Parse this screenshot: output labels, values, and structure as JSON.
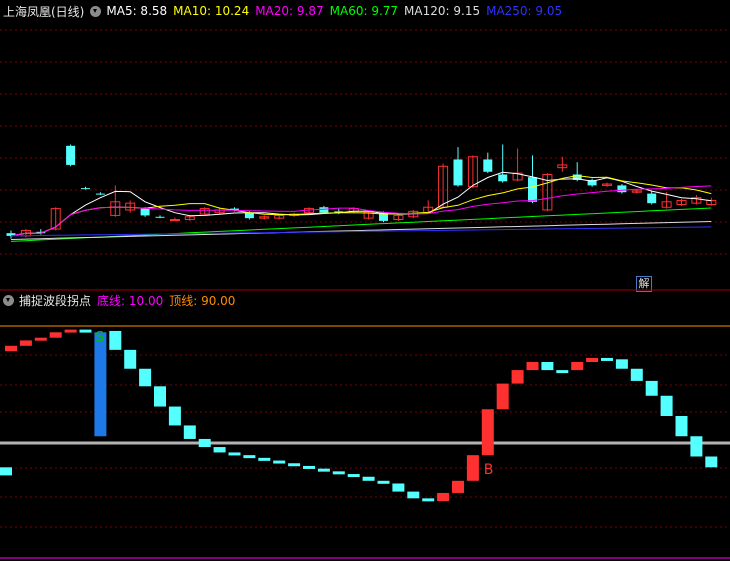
{
  "main": {
    "title": "上海凤凰(日线)",
    "ma": [
      {
        "label": "MA5: 8.58",
        "color": "#ffffff"
      },
      {
        "label": "MA10: 10.24",
        "color": "#ffff00"
      },
      {
        "label": "MA20: 9.87",
        "color": "#ff00ff"
      },
      {
        "label": "MA60: 9.77",
        "color": "#00ff00"
      },
      {
        "label": "MA120: 9.15",
        "color": "#dcdcdc"
      },
      {
        "label": "MA250: 9.05",
        "color": "#3030ff"
      }
    ],
    "badge": "解",
    "candles": [
      {
        "o": 8.85,
        "c": 8.75,
        "h": 8.95,
        "l": 8.65,
        "up": false
      },
      {
        "o": 8.75,
        "c": 8.95,
        "h": 9.0,
        "l": 8.7,
        "up": true
      },
      {
        "o": 8.9,
        "c": 8.85,
        "h": 9.0,
        "l": 8.8,
        "up": false
      },
      {
        "o": 9.0,
        "c": 9.75,
        "h": 9.8,
        "l": 8.95,
        "up": true
      },
      {
        "o": 12.05,
        "c": 11.35,
        "h": 12.1,
        "l": 11.3,
        "up": false
      },
      {
        "o": 10.5,
        "c": 10.5,
        "h": 10.55,
        "l": 10.45,
        "up": false
      },
      {
        "o": 10.3,
        "c": 10.3,
        "h": 10.35,
        "l": 10.25,
        "up": false
      },
      {
        "o": 9.5,
        "c": 10.0,
        "h": 10.6,
        "l": 9.45,
        "up": true
      },
      {
        "o": 9.95,
        "c": 9.7,
        "h": 10.05,
        "l": 9.6,
        "up": true
      },
      {
        "o": 9.75,
        "c": 9.5,
        "h": 9.8,
        "l": 9.45,
        "up": false
      },
      {
        "o": 9.45,
        "c": 9.45,
        "h": 9.5,
        "l": 9.4,
        "up": false
      },
      {
        "o": 9.35,
        "c": 9.35,
        "h": 9.42,
        "l": 9.3,
        "up": true
      },
      {
        "o": 9.35,
        "c": 9.45,
        "h": 9.5,
        "l": 9.3,
        "up": true
      },
      {
        "o": 9.55,
        "c": 9.75,
        "h": 9.8,
        "l": 9.5,
        "up": true
      },
      {
        "o": 9.6,
        "c": 9.7,
        "h": 9.8,
        "l": 9.55,
        "up": true
      },
      {
        "o": 9.75,
        "c": 9.7,
        "h": 9.8,
        "l": 9.65,
        "up": false
      },
      {
        "o": 9.6,
        "c": 9.4,
        "h": 9.65,
        "l": 9.35,
        "up": false
      },
      {
        "o": 9.4,
        "c": 9.45,
        "h": 9.5,
        "l": 9.35,
        "up": true
      },
      {
        "o": 9.4,
        "c": 9.5,
        "h": 9.55,
        "l": 9.35,
        "up": true
      },
      {
        "o": 9.5,
        "c": 9.55,
        "h": 9.6,
        "l": 9.45,
        "up": true
      },
      {
        "o": 9.6,
        "c": 9.75,
        "h": 9.8,
        "l": 9.55,
        "up": true
      },
      {
        "o": 9.8,
        "c": 9.6,
        "h": 9.85,
        "l": 9.55,
        "up": false
      },
      {
        "o": 9.65,
        "c": 9.6,
        "h": 9.75,
        "l": 9.55,
        "up": false
      },
      {
        "o": 9.65,
        "c": 9.75,
        "h": 9.8,
        "l": 9.6,
        "up": true
      },
      {
        "o": 9.4,
        "c": 9.6,
        "h": 9.65,
        "l": 9.35,
        "up": true
      },
      {
        "o": 9.6,
        "c": 9.3,
        "h": 9.65,
        "l": 9.25,
        "up": false
      },
      {
        "o": 9.35,
        "c": 9.5,
        "h": 9.55,
        "l": 9.3,
        "up": true
      },
      {
        "o": 9.45,
        "c": 9.65,
        "h": 9.7,
        "l": 9.4,
        "up": true
      },
      {
        "o": 9.6,
        "c": 9.8,
        "h": 10.05,
        "l": 9.55,
        "up": true
      },
      {
        "o": 9.8,
        "c": 11.3,
        "h": 11.4,
        "l": 9.75,
        "up": true
      },
      {
        "o": 11.55,
        "c": 10.6,
        "h": 12.0,
        "l": 10.55,
        "up": false
      },
      {
        "o": 10.55,
        "c": 11.65,
        "h": 11.7,
        "l": 10.5,
        "up": true
      },
      {
        "o": 11.55,
        "c": 11.1,
        "h": 11.8,
        "l": 11.05,
        "up": false
      },
      {
        "o": 11.0,
        "c": 10.75,
        "h": 12.1,
        "l": 10.7,
        "up": false
      },
      {
        "o": 10.8,
        "c": 11.05,
        "h": 11.95,
        "l": 10.75,
        "up": true
      },
      {
        "o": 10.9,
        "c": 10.0,
        "h": 11.7,
        "l": 9.95,
        "up": false
      },
      {
        "o": 9.7,
        "c": 11.0,
        "h": 11.05,
        "l": 9.65,
        "up": true
      },
      {
        "o": 11.25,
        "c": 11.35,
        "h": 11.65,
        "l": 11.1,
        "up": true
      },
      {
        "o": 11.0,
        "c": 10.8,
        "h": 11.45,
        "l": 10.75,
        "up": false
      },
      {
        "o": 10.8,
        "c": 10.6,
        "h": 10.85,
        "l": 10.55,
        "up": false
      },
      {
        "o": 10.6,
        "c": 10.65,
        "h": 10.7,
        "l": 10.55,
        "up": true
      },
      {
        "o": 10.6,
        "c": 10.35,
        "h": 10.65,
        "l": 10.3,
        "up": false
      },
      {
        "o": 10.35,
        "c": 10.4,
        "h": 10.45,
        "l": 10.3,
        "up": true
      },
      {
        "o": 10.3,
        "c": 9.95,
        "h": 10.4,
        "l": 9.9,
        "up": false
      },
      {
        "o": 9.8,
        "c": 10.0,
        "h": 10.35,
        "l": 9.75,
        "up": true
      },
      {
        "o": 9.9,
        "c": 10.05,
        "h": 10.1,
        "l": 9.85,
        "up": true
      },
      {
        "o": 9.95,
        "c": 10.15,
        "h": 10.25,
        "l": 9.9,
        "up": true
      },
      {
        "o": 9.9,
        "c": 10.05,
        "h": 10.15,
        "l": 9.85,
        "up": true
      }
    ]
  },
  "indicator": {
    "title": "捕捉波段拐点",
    "line_low_label": "底线: 10.00",
    "line_high_label": "顶线: 90.00",
    "line_low": 10,
    "line_high": 90,
    "buy_marker": "B",
    "sell_marker": "S",
    "bars": [
      {
        "o": 68,
        "c": 72,
        "up": true
      },
      {
        "o": 72,
        "c": 76,
        "up": true
      },
      {
        "o": 76,
        "c": 78,
        "up": true
      },
      {
        "o": 78,
        "c": 82,
        "up": true
      },
      {
        "o": 82,
        "c": 84,
        "up": true
      },
      {
        "o": 84,
        "c": 83,
        "up": false
      },
      {
        "o": 82,
        "c": 5,
        "up": false,
        "special": true
      },
      {
        "o": 83,
        "c": 69,
        "up": false
      },
      {
        "o": 69,
        "c": 55,
        "up": false
      },
      {
        "o": 55,
        "c": 42,
        "up": false
      },
      {
        "o": 42,
        "c": 27,
        "up": false
      },
      {
        "o": 27,
        "c": 13,
        "up": false
      },
      {
        "o": 13,
        "c": 3,
        "up": false
      },
      {
        "o": 3,
        "c": -3,
        "up": false
      },
      {
        "o": -3,
        "c": -7,
        "up": false
      },
      {
        "o": -7,
        "c": -9,
        "up": false
      },
      {
        "o": -9,
        "c": -11,
        "up": false
      },
      {
        "o": -11,
        "c": -13,
        "up": false
      },
      {
        "o": -13,
        "c": -15,
        "up": false
      },
      {
        "o": -15,
        "c": -17,
        "up": false
      },
      {
        "o": -17,
        "c": -19,
        "up": false
      },
      {
        "o": -19,
        "c": -21,
        "up": false
      },
      {
        "o": -21,
        "c": -23,
        "up": false
      },
      {
        "o": -23,
        "c": -25,
        "up": false
      },
      {
        "o": -25,
        "c": -28,
        "up": false
      },
      {
        "o": -28,
        "c": -30,
        "up": false
      },
      {
        "o": -30,
        "c": -36,
        "up": false
      },
      {
        "o": -36,
        "c": -41,
        "up": false
      },
      {
        "o": -41,
        "c": -43,
        "up": false
      },
      {
        "o": -43,
        "c": -37,
        "up": true
      },
      {
        "o": -37,
        "c": -28,
        "up": true
      },
      {
        "o": -28,
        "c": -9,
        "up": true
      },
      {
        "o": -9,
        "c": 25,
        "up": true
      },
      {
        "o": 25,
        "c": 44,
        "up": true
      },
      {
        "o": 44,
        "c": 54,
        "up": true
      },
      {
        "o": 54,
        "c": 60,
        "up": true
      },
      {
        "o": 60,
        "c": 54,
        "up": false
      },
      {
        "o": 54,
        "c": 54,
        "up": false
      },
      {
        "o": 54,
        "c": 60,
        "up": true
      },
      {
        "o": 60,
        "c": 63,
        "up": true
      },
      {
        "o": 63,
        "c": 62,
        "up": false
      },
      {
        "o": 62,
        "c": 55,
        "up": false
      },
      {
        "o": 55,
        "c": 46,
        "up": false
      },
      {
        "o": 46,
        "c": 35,
        "up": false
      },
      {
        "o": 35,
        "c": 20,
        "up": false
      },
      {
        "o": 20,
        "c": 5,
        "up": false
      },
      {
        "o": 5,
        "c": -10,
        "up": false
      },
      {
        "o": -10,
        "c": -18,
        "up": false
      },
      {
        "o": -18,
        "c": -24,
        "up": false
      }
    ]
  }
}
